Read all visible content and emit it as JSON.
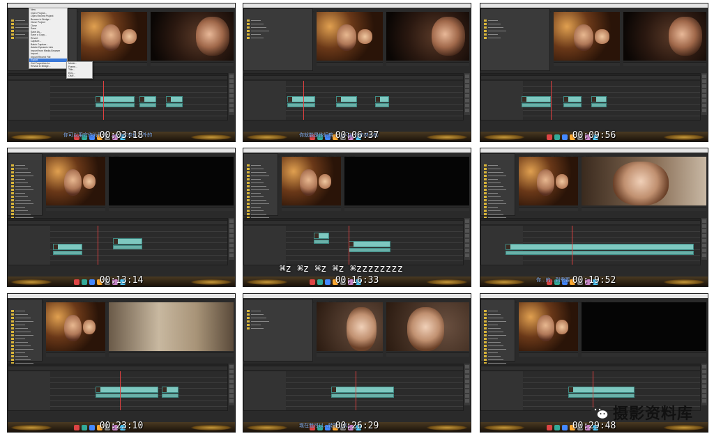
{
  "menubar": {
    "app": "Premiere Pro",
    "items": [
      "File",
      "Edit",
      "Project",
      "Clip",
      "Sequence",
      "Marker",
      "Title",
      "Window",
      "Help"
    ]
  },
  "file_menu": {
    "items": [
      "New",
      "Open Project...",
      "Open Recent Project",
      "Browse in Bridge...",
      "Close Project",
      "Close",
      "Save",
      "Save As...",
      "Save a Copy...",
      "Revert",
      "Capture...",
      "Batch Capture...",
      "Adobe Dynamic Link",
      "Import from Media Browser",
      "Import...",
      "Import Recent File",
      "Export",
      "Get Properties for",
      "Reveal in Bridge..."
    ],
    "submenu": [
      "Movie...",
      "Frame...",
      "Title...",
      "EDL...",
      "OMF..."
    ]
  },
  "frames": [
    {
      "timecode": "00:03:18",
      "subtitle": "你可以用它作为预览 ... cut这些段之外的"
    },
    {
      "timecode": "00:06:37",
      "subtitle": "你就能是他们剪... 以可以自由移动的"
    },
    {
      "timecode": "00:09:56",
      "subtitle": ""
    },
    {
      "timecode": "00:13:14",
      "subtitle": ""
    },
    {
      "timecode": "00:16:33",
      "subtitle": ""
    },
    {
      "timecode": "00:19:52",
      "subtitle": "你...的...到需要"
    },
    {
      "timecode": "00:23:10",
      "subtitle": ""
    },
    {
      "timecode": "00:26:29",
      "subtitle": "现在我可以...转换工具"
    },
    {
      "timecode": "00:29:48",
      "subtitle": ""
    }
  ],
  "keystroke_overlay": "⌘z ⌘z ⌘z ⌘z ⌘zzzzzzzz",
  "watermark": {
    "text": "摄影资料库",
    "icon": "wechat-icon"
  },
  "colors": {
    "clip": "#7ec8c0",
    "playhead": "#e04040",
    "timecode_text": "#ffffff"
  }
}
